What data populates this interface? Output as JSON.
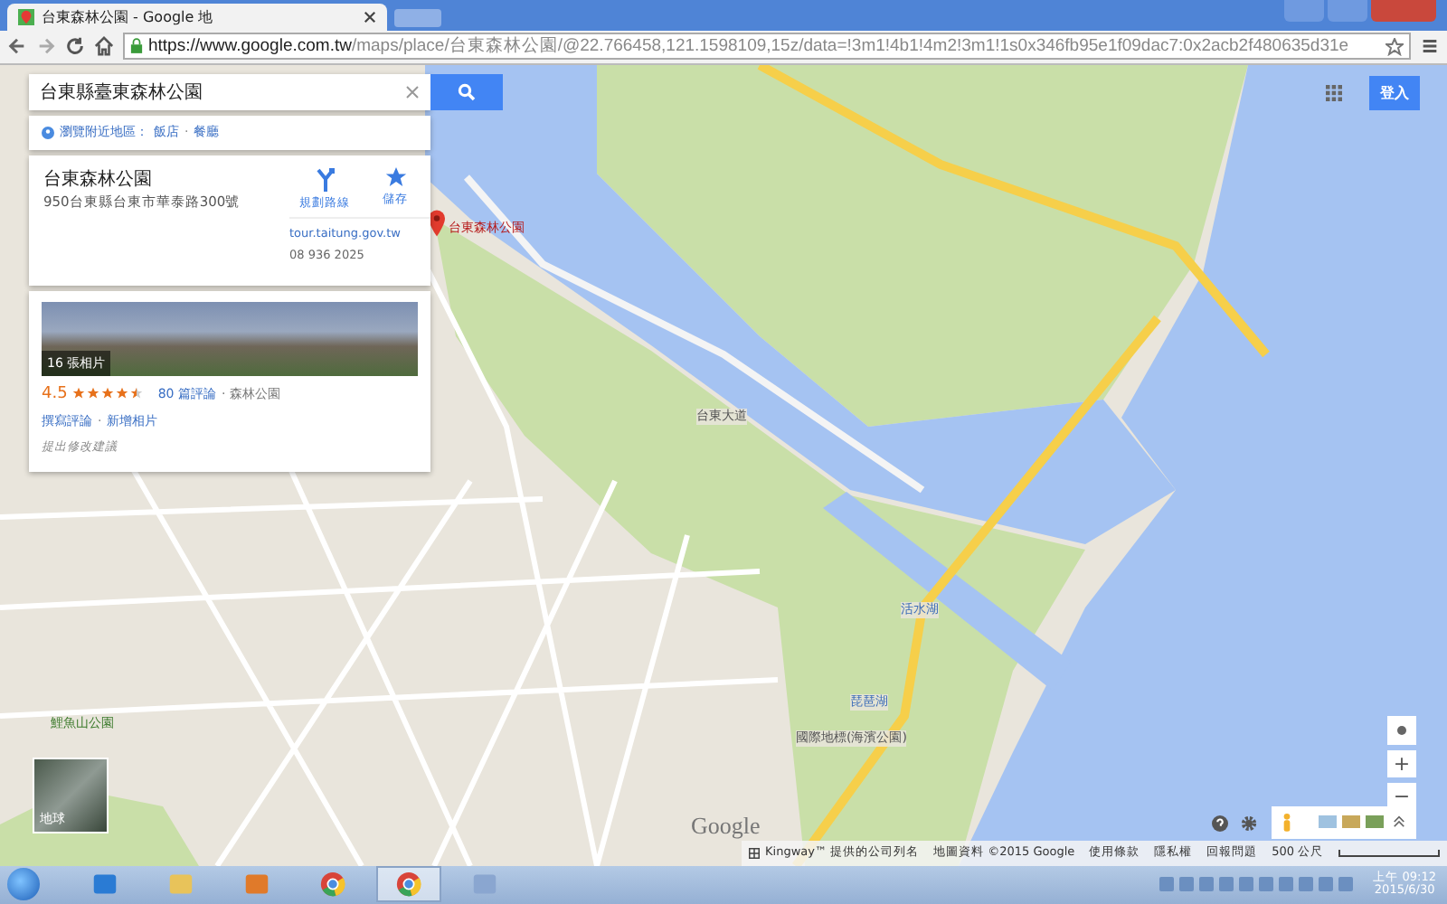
{
  "browser": {
    "tab_title": "台東森林公園 - Google 地",
    "url_host": "https://www.google.com.tw",
    "url_path": "/maps/place/台東森林公園/@22.766458,121.1598109,15z/data=!3m1!4b1!4m2!3m1!1s0x346fb95e1f09dac7:0x2acb2f480635d31e"
  },
  "search": {
    "value": "台東縣臺東森林公園"
  },
  "nearby": {
    "label": "瀏覽附近地區：",
    "links": [
      "飯店",
      "餐廳"
    ],
    "separator": "·"
  },
  "place": {
    "name": "台東森林公園",
    "address": "950台東縣台東市華泰路300號",
    "website": "tour.taitung.gov.tw",
    "phone": "08 936 2025",
    "actions": [
      {
        "kind": "directions",
        "label": "規劃路線"
      },
      {
        "kind": "save",
        "label": "儲存"
      }
    ],
    "photo_count": "16 張相片",
    "rating": "4.5",
    "stars": 4.5,
    "reviews": "80 篇評論",
    "category": "· 森林公園",
    "links": [
      "撰寫評論",
      "新增相片"
    ],
    "link_separator": "·",
    "suggest_edit": "提出修改建議"
  },
  "map": {
    "marker_label": "台東森林公園",
    "labels": [
      {
        "text": "鯉魚山公園",
        "kind": "park"
      },
      {
        "text": "國際地標(海濱公園)",
        "kind": "place"
      },
      {
        "text": "活水湖",
        "kind": "water"
      },
      {
        "text": "琵琶湖",
        "kind": "water"
      },
      {
        "text": "台東大道",
        "kind": "road"
      }
    ],
    "earth_label": "地球",
    "logo": "Google",
    "zoom": [
      "+",
      "−"
    ]
  },
  "header": {
    "sign_in": "登入"
  },
  "footer": {
    "items": [
      "Kingway™ 提供的公司列名",
      "地圖資料 ©2015 Google",
      "使用條款",
      "隱私權",
      "回報問題"
    ],
    "scale": "500 公尺"
  },
  "taskbar": {
    "apps": [
      {
        "kind": "ie",
        "selected": false
      },
      {
        "kind": "folder",
        "selected": false
      },
      {
        "kind": "media",
        "selected": false
      },
      {
        "kind": "chrome",
        "selected": false
      },
      {
        "kind": "chrome",
        "selected": true
      },
      {
        "kind": "paint",
        "selected": false
      }
    ],
    "time": "上午 09:12",
    "date": "2015/6/30"
  }
}
